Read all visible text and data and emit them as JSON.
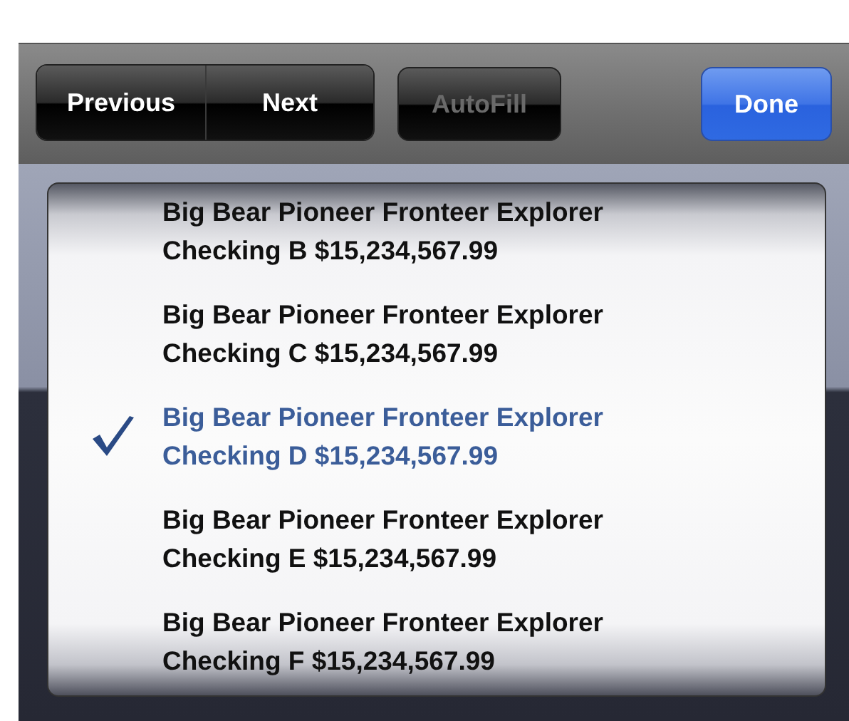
{
  "toolbar": {
    "buttons": [
      {
        "label": "Previous",
        "kind": "segment",
        "disabled": false
      },
      {
        "label": "Next",
        "kind": "segment",
        "disabled": false
      },
      {
        "label": "AutoFill",
        "kind": "plain",
        "disabled": true
      },
      {
        "label": "Done",
        "kind": "primary",
        "disabled": false
      }
    ]
  },
  "picker": {
    "options": [
      {
        "lines": [
          "Big Bear Pioneer Fronteer Explorer",
          "Checking B $15,234,567.99"
        ],
        "selected": false
      },
      {
        "lines": [
          "Big Bear Pioneer Fronteer Explorer",
          "Checking C $15,234,567.99"
        ],
        "selected": false
      },
      {
        "lines": [
          "Big Bear Pioneer Fronteer Explorer",
          "Checking D $15,234,567.99"
        ],
        "selected": true
      },
      {
        "lines": [
          "Big Bear Pioneer Fronteer Explorer",
          "Checking E $15,234,567.99"
        ],
        "selected": false
      },
      {
        "lines": [
          "Big Bear Pioneer Fronteer Explorer",
          "Checking F $15,234,567.99"
        ],
        "selected": false
      }
    ]
  }
}
